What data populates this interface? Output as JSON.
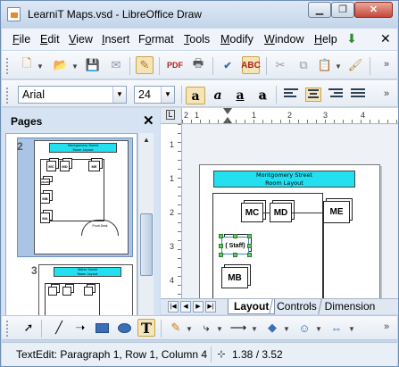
{
  "window": {
    "title": "LearniT Maps.vsd - LibreOffice Draw"
  },
  "menubar": {
    "items": [
      {
        "pre": "",
        "ul": "F",
        "post": "ile"
      },
      {
        "pre": "",
        "ul": "E",
        "post": "dit"
      },
      {
        "pre": "",
        "ul": "V",
        "post": "iew"
      },
      {
        "pre": "",
        "ul": "I",
        "post": "nsert"
      },
      {
        "pre": "F",
        "ul": "o",
        "post": "rmat"
      },
      {
        "pre": "",
        "ul": "T",
        "post": "ools"
      },
      {
        "pre": "",
        "ul": "M",
        "post": "odify"
      },
      {
        "pre": "",
        "ul": "W",
        "post": "indow"
      },
      {
        "pre": "",
        "ul": "H",
        "post": "elp"
      }
    ]
  },
  "format_toolbar": {
    "font_name": "Arial",
    "font_size": "24",
    "styles": [
      "a",
      "a",
      "a",
      "a"
    ]
  },
  "pages_panel": {
    "title": "Pages",
    "pages": [
      {
        "number": "2",
        "header_line1": "Montgomery Street",
        "header_line2": "Room Layout",
        "labels": [
          "MC",
          "MD",
          "ME",
          "(Staff)",
          "MB",
          "MA",
          "Front Desk"
        ]
      },
      {
        "number": "3",
        "header_line1": "Water Street",
        "header_line2": "Room Layout",
        "labels": []
      }
    ]
  },
  "canvas": {
    "header_line1": "Montgomery Street",
    "header_line2": "Room Layout",
    "rooms": [
      "MC",
      "MD",
      "ME",
      "( Staff)",
      "MB"
    ]
  },
  "ruler": {
    "h_numbers": [
      "2",
      "1",
      "1",
      "2",
      "3",
      "4"
    ],
    "v_numbers": [
      "1",
      "1",
      "2",
      "3",
      "4",
      "5"
    ]
  },
  "tabs": [
    "Layout",
    "Controls",
    "Dimension Lines"
  ],
  "status": {
    "edit_text": "TextEdit: Paragraph 1, Row 1, Column 4",
    "position": "1.38 / 3.52"
  }
}
